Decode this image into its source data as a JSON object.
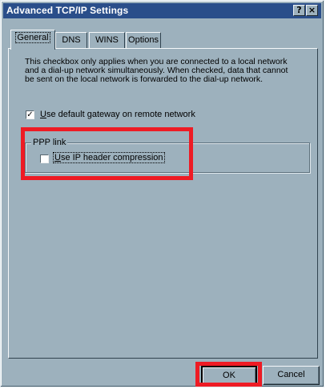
{
  "window": {
    "title": "Advanced TCP/IP Settings",
    "help_button": "?",
    "close_button": "×"
  },
  "tabs": [
    {
      "label": "General",
      "active": true
    },
    {
      "label": "DNS",
      "active": false
    },
    {
      "label": "WINS",
      "active": false
    },
    {
      "label": "Options",
      "active": false
    }
  ],
  "general": {
    "description": "This checkbox only applies when you are connected to a local network and a dial-up network simultaneously.  When checked, data that cannot be sent on the local network is forwarded to the dial-up network.",
    "use_default_gateway": {
      "checked": true,
      "accel": "U",
      "label_rest": "se default gateway on remote network"
    },
    "ppp_link": {
      "group_label": "PPP link",
      "use_ip_header_compression": {
        "checked": false,
        "accel": "U",
        "label_rest": "se IP header compression"
      }
    }
  },
  "buttons": {
    "ok": "OK",
    "cancel": "Cancel"
  },
  "highlight_color": "#ee1b24",
  "colors": {
    "titlebar": "#2a4e8a",
    "dialog_face": "#9db1bd"
  }
}
